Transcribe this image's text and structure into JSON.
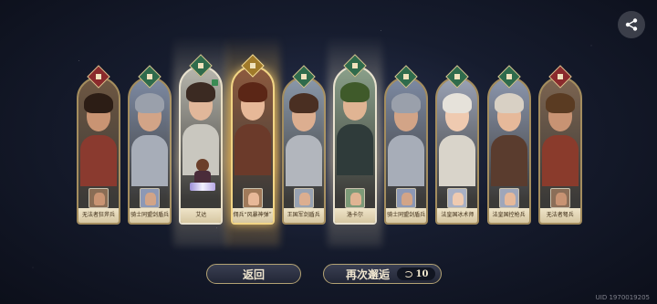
{
  "cards": [
    {
      "name": "无法者狂斧兵",
      "frame": "normal",
      "badge": "red",
      "beam": "none",
      "bg": "#6e5742",
      "hair": "#2c1d15",
      "body": "#8a3a2f",
      "skin": "#c99473",
      "item_color": "#8a6d55",
      "avatar": false
    },
    {
      "name": "骑士同盟剑盾兵",
      "frame": "normal",
      "badge": "green",
      "beam": "none",
      "bg": "#7d8aa3",
      "hair": "#9aa0ab",
      "body": "#a7adb8",
      "skin": "#d2a487",
      "item_color": "#8c98b5",
      "avatar": false
    },
    {
      "name": "艾达",
      "frame": "white",
      "badge": "green",
      "beam": "white",
      "bg": "#b7b6ad",
      "hair": "#3b2a22",
      "body": "#c9c7bf",
      "skin": "#e1b79a",
      "item_color": "#9b9387",
      "avatar": true
    },
    {
      "name": "佣兵“风暴神弹”",
      "frame": "gold",
      "badge": "gold",
      "beam": "gold",
      "bg": "#8d5a3e",
      "hair": "#5b2616",
      "body": "#6b3a2a",
      "skin": "#e7b898",
      "item_color": "#a07a5a",
      "avatar": false
    },
    {
      "name": "王国军剑盾兵",
      "frame": "normal",
      "badge": "green",
      "beam": "none",
      "bg": "#8a98aa",
      "hair": "#4a2f22",
      "body": "#b2b6bd",
      "skin": "#dcae90",
      "item_color": "#98a2b2",
      "avatar": false
    },
    {
      "name": "洛卡尔",
      "frame": "white",
      "badge": "green",
      "beam": "white",
      "bg": "#8aa08a",
      "hair": "#3f5a2a",
      "body": "#2f3b3a",
      "skin": "#e0b493",
      "item_color": "#7d9a78",
      "avatar": false
    },
    {
      "name": "骑士同盟剑盾兵",
      "frame": "normal",
      "badge": "green",
      "beam": "none",
      "bg": "#7d8aa3",
      "hair": "#9aa0ab",
      "body": "#a7adb8",
      "skin": "#d2a487",
      "item_color": "#8c98b5",
      "avatar": false
    },
    {
      "name": "法皇国冰术师",
      "frame": "normal",
      "badge": "green",
      "beam": "none",
      "bg": "#9aa2b5",
      "hair": "#e6e2da",
      "body": "#d9d4ca",
      "skin": "#efcab0",
      "item_color": "#a9b0c4",
      "avatar": false
    },
    {
      "name": "法皇国控枪兵",
      "frame": "normal",
      "badge": "green",
      "beam": "none",
      "bg": "#8b96ad",
      "hair": "#d8d0c4",
      "body": "#5a3c2e",
      "skin": "#e6b99a",
      "item_color": "#9ea6ba",
      "avatar": false
    },
    {
      "name": "无法者弩兵",
      "frame": "normal",
      "badge": "red",
      "beam": "none",
      "bg": "#7c6450",
      "hair": "#5a3b22",
      "body": "#8a3b2c",
      "skin": "#c89373",
      "item_color": "#8b6e58",
      "avatar": false
    }
  ],
  "buttons": {
    "back_label": "返回",
    "again_label": "再次邂逅",
    "cost_value": "10"
  },
  "uid_text": "UID 1970019205",
  "icons": {
    "share": "share-icon",
    "currency": "crescent-currency-icon"
  }
}
